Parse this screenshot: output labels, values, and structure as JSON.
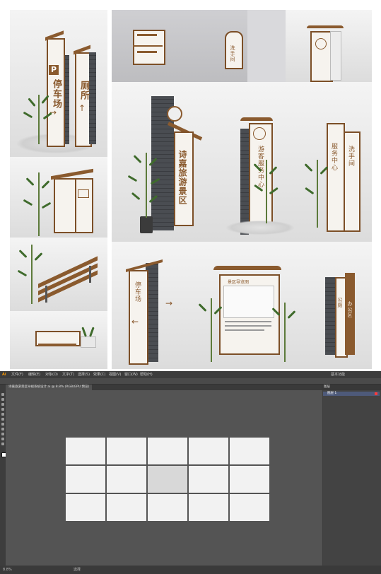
{
  "signs": {
    "parking": "停车场",
    "restroom": "洗手间",
    "toilet": "厕所",
    "scenic_name": "诗嘉旅游景区",
    "scenic_name_2": "诗嘉旅游景区",
    "service_center": "游客服务中心",
    "washroom": "洗手间",
    "parking_2": "停车场",
    "visitor_notice": "游客须知",
    "map_title": "景区导览图",
    "info_center": "服务中心",
    "toilet_2": "公厕",
    "office": "办公区"
  },
  "window": {
    "tab_title": "诗嘉旅游景区导视系统设计.ai @ 8.8% (RGB/GPU 预览)",
    "menus": [
      "Ai",
      "文件(F)",
      "编辑(E)",
      "对象(O)",
      "文字(T)",
      "选择(S)",
      "效果(C)",
      "视图(V)",
      "窗口(W)",
      "帮助(H)"
    ],
    "workspace": "基本功能",
    "panel_title": "图层",
    "layer_name": "图层 1",
    "zoom": "8.8%",
    "status_tool": "选择"
  },
  "icons": [
    "select-tool-icon",
    "direct-select-icon",
    "pen-tool-icon",
    "type-tool-icon",
    "rectangle-tool-icon",
    "brush-tool-icon",
    "rotate-tool-icon",
    "scale-tool-icon",
    "eyedropper-icon",
    "hand-tool-icon",
    "zoom-tool-icon",
    "fill-stroke-icon"
  ]
}
